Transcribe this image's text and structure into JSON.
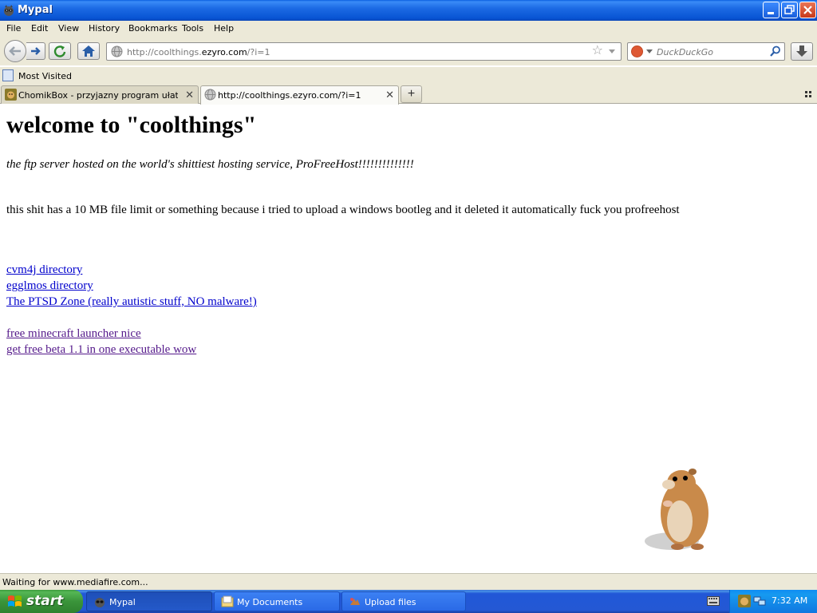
{
  "window": {
    "title": "Mypal"
  },
  "menu": [
    "File",
    "Edit",
    "View",
    "History",
    "Bookmarks",
    "Tools",
    "Help"
  ],
  "nav": {
    "url_prefix": "http://coolthings.",
    "url_host": "ezyro.com",
    "url_suffix": "/?i=1",
    "search_placeholder": "DuckDuckGo"
  },
  "bookmarks": {
    "most_visited": "Most Visited"
  },
  "tabs": [
    {
      "label": "ChomikBox - przyjazny program ułatwiaj...",
      "active": false
    },
    {
      "label": "http://coolthings.ezyro.com/?i=1",
      "active": true
    }
  ],
  "page": {
    "heading": "welcome to \"coolthings\"",
    "subtitle": "the ftp server hosted on the world's shittiest hosting service, ProFreeHost!!!!!!!!!!!!!!",
    "paragraph": "this shit has a 10 MB file limit or something because i tried to upload a windows bootleg and it deleted it automatically fuck you profreehost",
    "links": [
      {
        "text": "cvm4j directory",
        "visited": false
      },
      {
        "text": "egglmos directory",
        "visited": false
      },
      {
        "text": "The PTSD Zone (really autistic stuff, NO malware!)",
        "visited": false
      },
      {
        "text": "free minecraft launcher nice",
        "visited": true
      },
      {
        "text": "get free beta 1.1 in one executable wow",
        "visited": true
      }
    ]
  },
  "status": {
    "text": "Waiting for www.mediafire.com..."
  },
  "taskbar": {
    "start_label": "start",
    "tasks": [
      {
        "label": "Mypal",
        "active": true
      },
      {
        "label": "My Documents",
        "active": false
      },
      {
        "label": "Upload files",
        "active": false
      }
    ],
    "clock": "7:32 AM"
  },
  "icons": {
    "app": "mypal-raccoon-icon",
    "back": "back-arrow-icon",
    "forward": "forward-arrow-icon",
    "reload": "reload-icon",
    "home": "home-icon",
    "bookmark_star": "star-icon",
    "search": "magnifier-icon",
    "download": "download-icon",
    "new_tab": "plus-icon",
    "hamster": "dancing-hamster-gif"
  },
  "colors": {
    "link_unvisited": "#0000cc",
    "link_visited": "#551a8b",
    "xp_blue": "#245edb",
    "xp_green": "#3a943a"
  }
}
